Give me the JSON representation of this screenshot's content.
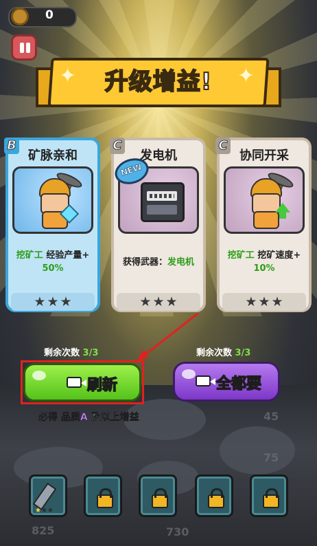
{
  "hud": {
    "coins": "0"
  },
  "banner": {
    "title": "升级增益!"
  },
  "cards": [
    {
      "rank": "B",
      "title": "矿脉亲和",
      "desc_highlight": "挖矿工",
      "desc_text": " 经验产量+",
      "desc_value": "50%",
      "stars": 3,
      "new_badge": ""
    },
    {
      "rank": "C",
      "title": "发电机",
      "desc_highlight": "",
      "desc_text": "获得武器：",
      "desc_value": "发电机",
      "stars": 3,
      "new_badge": "NEW"
    },
    {
      "rank": "C",
      "title": "协同开采",
      "desc_highlight": "挖矿工",
      "desc_text": " 挖矿速度+",
      "desc_value": "10%",
      "stars": 3,
      "new_badge": ""
    }
  ],
  "remaining": {
    "left_label": "剩余次数",
    "left_value": "3/3",
    "right_label": "剩余次数",
    "right_value": "3/3"
  },
  "buttons": {
    "refresh": "刷新",
    "take_all": "全都要"
  },
  "guarantee": {
    "prefix": "必得",
    "quality": "品质A",
    "suffix": "及以上增益"
  },
  "background_numbers": [
    "45",
    "75",
    "825",
    "730"
  ],
  "slots": [
    {
      "type": "weapon",
      "icon": "drill-icon",
      "stars": 1,
      "max_stars": 3
    },
    {
      "type": "locked",
      "icon": "lock-icon"
    },
    {
      "type": "locked",
      "icon": "lock-icon"
    },
    {
      "type": "locked",
      "icon": "lock-icon"
    },
    {
      "type": "locked",
      "icon": "lock-icon"
    }
  ],
  "colors": {
    "highlight_green": "#2e9d19",
    "quality_purple": "#c980ff",
    "refresh_green": "#54c21b",
    "all_purple": "#7d37c8",
    "annotation_red": "#e0221e"
  }
}
